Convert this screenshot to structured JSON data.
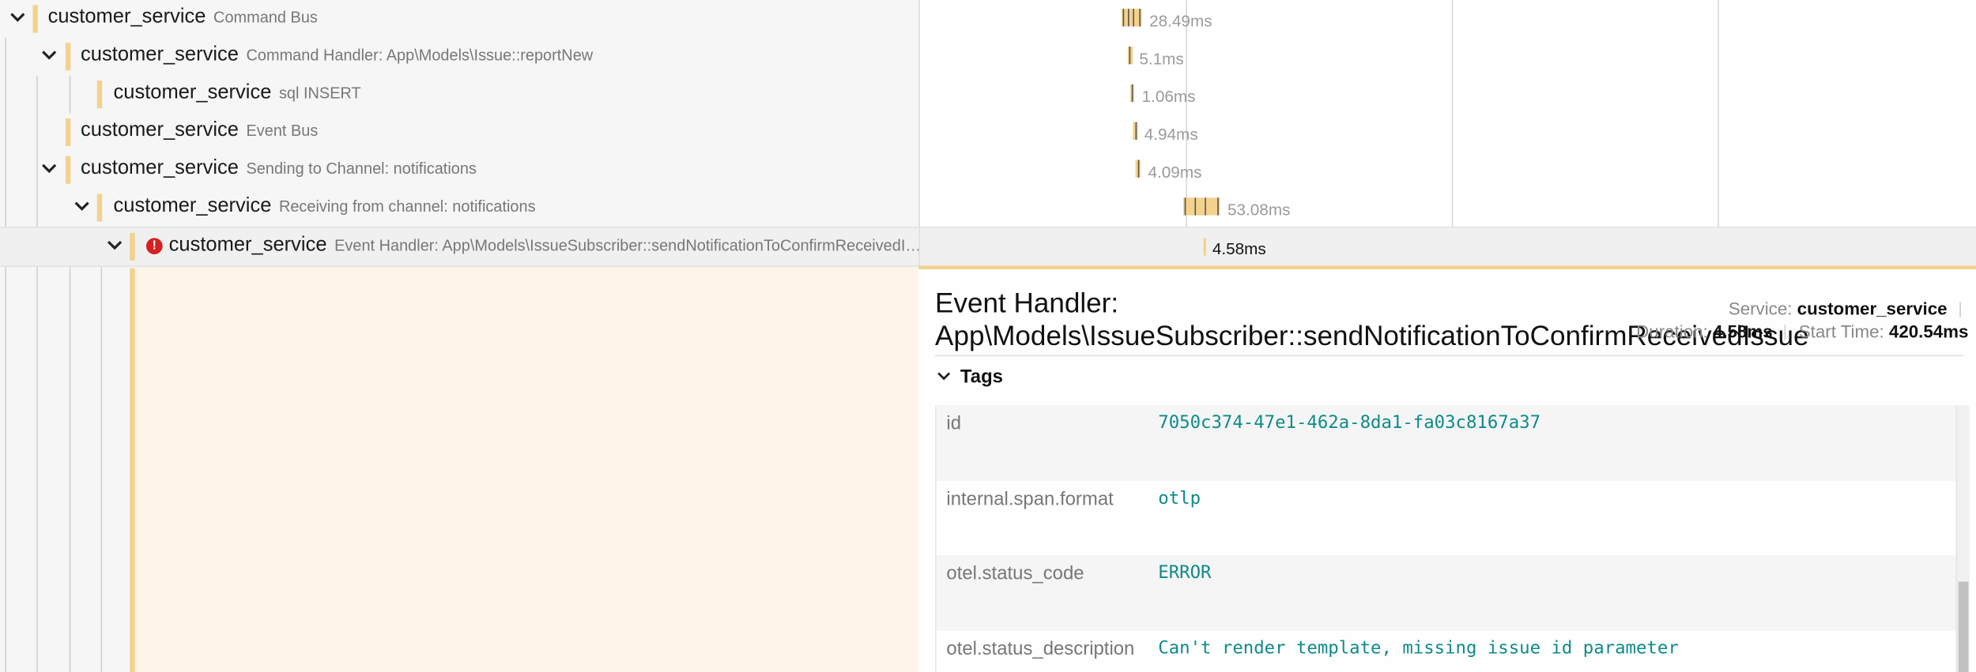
{
  "spans": [
    {
      "service": "customer_service",
      "operation": "Command Bus",
      "duration": "28.49ms",
      "expanded": true,
      "error": false
    },
    {
      "service": "customer_service",
      "operation": "Command Handler: App\\Models\\Issue::reportNew",
      "duration": "5.1ms",
      "expanded": true,
      "error": false
    },
    {
      "service": "customer_service",
      "operation": "sql INSERT",
      "duration": "1.06ms",
      "expanded": false,
      "error": false
    },
    {
      "service": "customer_service",
      "operation": "Event Bus",
      "duration": "4.94ms",
      "expanded": false,
      "error": false
    },
    {
      "service": "customer_service",
      "operation": "Sending to Channel: notifications",
      "duration": "4.09ms",
      "expanded": true,
      "error": false
    },
    {
      "service": "customer_service",
      "operation": "Receiving from channel: notifications",
      "duration": "53.08ms",
      "expanded": true,
      "error": false
    },
    {
      "service": "customer_service",
      "operation": "Event Handler: App\\Models\\IssueSubscriber::sendNotificationToConfirmReceivedI…",
      "duration": "4.58ms",
      "expanded": true,
      "error": true,
      "selected": true
    }
  ],
  "detail": {
    "title": "Event Handler: App\\Models\\IssueSubscriber::sendNotificationToConfirmReceivedIssue",
    "service_label": "Service:",
    "service_value": "customer_service",
    "duration_label": "Duration:",
    "duration_value": "4.58ms",
    "start_label": "Start Time:",
    "start_value": "420.54ms",
    "tags_header": "Tags",
    "tags": [
      {
        "key": "id",
        "value": "7050c374-47e1-462a-8da1-fa03c8167a37"
      },
      {
        "key": "internal.span.format",
        "value": "otlp"
      },
      {
        "key": "otel.status_code",
        "value": "ERROR"
      },
      {
        "key": "otel.status_description",
        "value": "Can't render template, missing issue id parameter"
      }
    ]
  },
  "colors": {
    "span_accent": "#f3d28e",
    "detail_bg": "#fef5e8",
    "tag_value": "#0f8a8a",
    "error": "#d42020"
  }
}
